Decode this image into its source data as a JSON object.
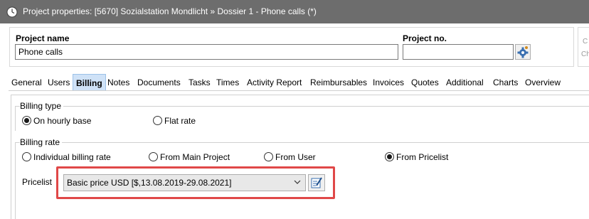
{
  "window": {
    "title": "Project properties: [5670] Sozialstation Mondlicht » Dossier 1 - Phone calls (*)"
  },
  "project": {
    "name_label": "Project name",
    "name_value": "Phone calls",
    "no_label": "Project no.",
    "no_value": ""
  },
  "side_panel": {
    "lines": [
      "C",
      "Ch"
    ]
  },
  "tabs": [
    {
      "label": "General",
      "active": false
    },
    {
      "label": "Users",
      "active": false
    },
    {
      "label": "Billing",
      "active": true
    },
    {
      "label": "Notes",
      "active": false
    },
    {
      "label": "Documents",
      "active": false
    },
    {
      "label": "Tasks",
      "active": false
    },
    {
      "label": "Times",
      "active": false
    },
    {
      "label": "Activity Report",
      "active": false
    },
    {
      "label": "Reimbursables",
      "active": false
    },
    {
      "label": "Invoices",
      "active": false
    },
    {
      "label": "Quotes",
      "active": false
    },
    {
      "label": "Additional",
      "active": false
    },
    {
      "label": "Charts",
      "active": false
    },
    {
      "label": "Overview",
      "active": false
    }
  ],
  "billing_type": {
    "title": "Billing type",
    "options": [
      {
        "label": "On hourly base",
        "selected": true
      },
      {
        "label": "Flat rate",
        "selected": false
      }
    ]
  },
  "billing_rate": {
    "title": "Billing rate",
    "options": [
      {
        "label": "Individual billing rate",
        "selected": false
      },
      {
        "label": "From Main Project",
        "selected": false
      },
      {
        "label": "From User",
        "selected": false
      },
      {
        "label": "From Pricelist",
        "selected": true
      }
    ]
  },
  "pricelist": {
    "label": "Pricelist",
    "selected": "Basic price USD [$,13.08.2019-29.08.2021]"
  },
  "colors": {
    "titlebar": "#6d6d6d",
    "active_tab": "#cfe2f7",
    "highlight": "#e04848"
  }
}
